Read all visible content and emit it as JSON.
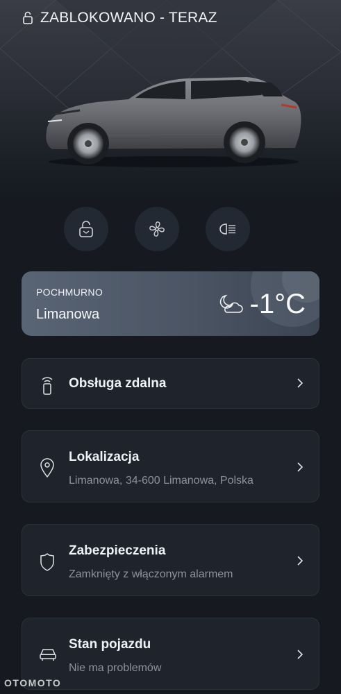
{
  "status": {
    "lock_text": "ZABLOKOWANO - TERAZ"
  },
  "quick_actions": [
    {
      "name": "lock-button",
      "icon": "padlock-icon"
    },
    {
      "name": "climate-button",
      "icon": "fan-icon"
    },
    {
      "name": "lights-button",
      "icon": "headlight-icon"
    }
  ],
  "weather": {
    "condition": "POCHMURNO",
    "city": "Limanowa",
    "temperature": "-1°C",
    "icon": "moon-cloud-icon"
  },
  "cards": [
    {
      "title": "Obsługa zdalna",
      "subtitle": "",
      "icon": "remote-key-icon"
    },
    {
      "title": "Lokalizacja",
      "subtitle": "Limanowa, 34-600 Limanowa, Polska",
      "icon": "location-pin-icon"
    },
    {
      "title": "Zabezpieczenia",
      "subtitle": "Zamknięty z włączonym alarmem",
      "icon": "shield-icon"
    },
    {
      "title": "Stan pojazdu",
      "subtitle": "Nie ma problemów",
      "icon": "car-icon"
    }
  ],
  "watermark": "OTOMOTO",
  "colors": {
    "background": "#161a20",
    "card": "#1f242c",
    "weather_card": "#535e6e",
    "car_body": "#6b6d72"
  }
}
